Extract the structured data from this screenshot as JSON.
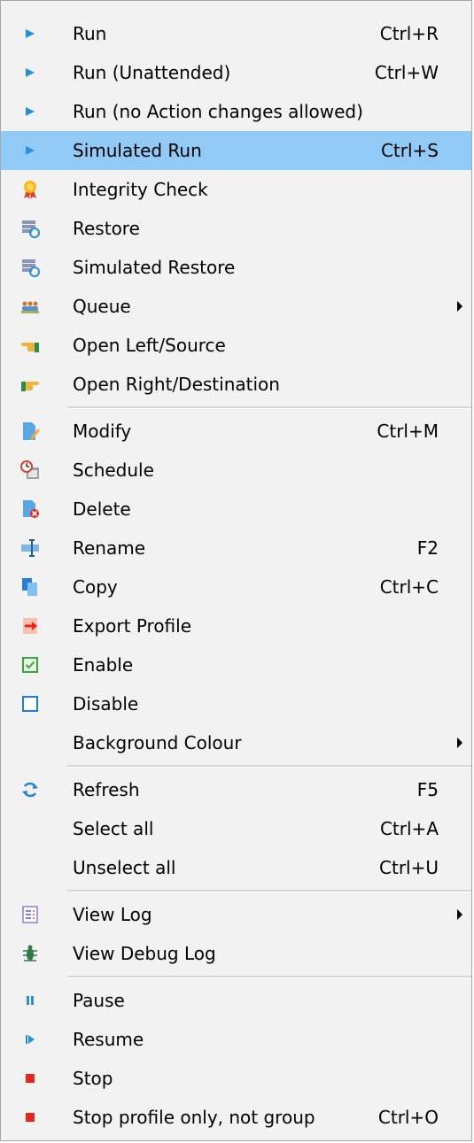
{
  "menu": {
    "items": [
      {
        "label": "Run",
        "shortcut": "Ctrl+R",
        "icon": "play-icon"
      },
      {
        "label": "Run (Unattended)",
        "shortcut": "Ctrl+W",
        "icon": "play-icon"
      },
      {
        "label": "Run (no Action changes allowed)",
        "shortcut": "",
        "icon": "play-icon"
      },
      {
        "label": "Simulated Run",
        "shortcut": "Ctrl+S",
        "icon": "play-icon",
        "highlighted": true
      },
      {
        "label": "Integrity Check",
        "shortcut": "",
        "icon": "award-icon"
      },
      {
        "label": "Restore",
        "shortcut": "",
        "icon": "restore-icon"
      },
      {
        "label": "Simulated Restore",
        "shortcut": "",
        "icon": "restore-icon"
      },
      {
        "label": "Queue",
        "shortcut": "",
        "icon": "queue-icon",
        "submenu": true
      },
      {
        "label": "Open Left/Source",
        "shortcut": "",
        "icon": "hand-left-icon"
      },
      {
        "label": "Open Right/Destination",
        "shortcut": "",
        "icon": "hand-right-icon"
      },
      {
        "label": "Modify",
        "shortcut": "Ctrl+M",
        "icon": "edit-icon"
      },
      {
        "label": "Schedule",
        "shortcut": "",
        "icon": "schedule-icon"
      },
      {
        "label": "Delete",
        "shortcut": "",
        "icon": "delete-icon"
      },
      {
        "label": "Rename",
        "shortcut": "F2",
        "icon": "rename-icon"
      },
      {
        "label": "Copy",
        "shortcut": "Ctrl+C",
        "icon": "copy-icon"
      },
      {
        "label": "Export Profile",
        "shortcut": "",
        "icon": "export-icon"
      },
      {
        "label": "Enable",
        "shortcut": "",
        "icon": "checkbox-checked-icon"
      },
      {
        "label": "Disable",
        "shortcut": "",
        "icon": "checkbox-empty-icon"
      },
      {
        "label": "Background Colour",
        "shortcut": "",
        "icon": "",
        "submenu": true
      },
      {
        "label": "Refresh",
        "shortcut": "F5",
        "icon": "refresh-icon"
      },
      {
        "label": "Select all",
        "shortcut": "Ctrl+A",
        "icon": ""
      },
      {
        "label": "Unselect all",
        "shortcut": "Ctrl+U",
        "icon": ""
      },
      {
        "label": "View Log",
        "shortcut": "",
        "icon": "log-icon",
        "submenu": true
      },
      {
        "label": "View Debug Log",
        "shortcut": "",
        "icon": "bug-icon"
      },
      {
        "label": "Pause",
        "shortcut": "",
        "icon": "pause-icon"
      },
      {
        "label": "Resume",
        "shortcut": "",
        "icon": "resume-icon"
      },
      {
        "label": "Stop",
        "shortcut": "",
        "icon": "stop-icon"
      },
      {
        "label": "Stop profile only, not group",
        "shortcut": "Ctrl+O",
        "icon": "stop-icon"
      }
    ]
  },
  "colors": {
    "highlight": "#91c9f7",
    "play": "#2b8fd6",
    "stop": "#e8261b",
    "checkbox_green": "#3aa53a",
    "checkbox_blue": "#1e7fd8"
  }
}
